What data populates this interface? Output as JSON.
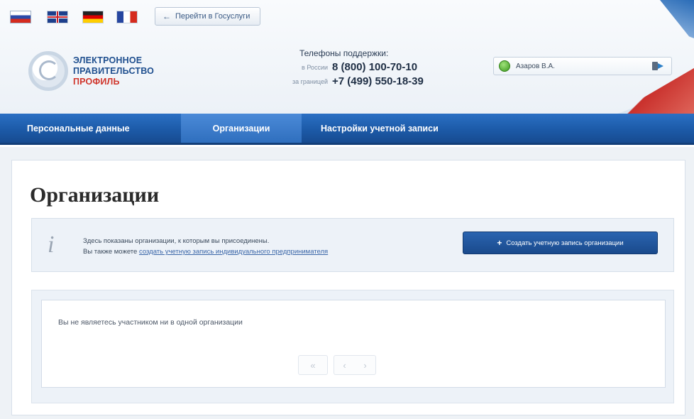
{
  "header": {
    "languages": [
      {
        "code": "ru",
        "icon": "flag-russia-icon"
      },
      {
        "code": "en",
        "icon": "flag-uk-icon"
      },
      {
        "code": "de",
        "icon": "flag-germany-icon"
      },
      {
        "code": "fr",
        "icon": "flag-france-icon"
      }
    ],
    "goto_button": "Перейти в Госуслуги",
    "logo": {
      "line1": "ЭЛЕКТРОННОЕ",
      "line2": "ПРАВИТЕЛЬСТВО",
      "line3": "ПРОФИЛЬ"
    },
    "support": {
      "title": "Телефоны поддержки:",
      "rows": [
        {
          "note": "в России",
          "number": "8 (800) 100-70-10"
        },
        {
          "note": "за границей",
          "number": "+7 (499) 550-18-39"
        }
      ]
    },
    "user": {
      "name": "Азаров В.А."
    }
  },
  "nav": {
    "items": [
      {
        "label": "Персональные данные",
        "active": false
      },
      {
        "label": "Организации",
        "active": true
      },
      {
        "label": "Настройки учетной записи",
        "active": false
      }
    ]
  },
  "main": {
    "title": "Организации",
    "info": {
      "line1": "Здесь показаны организации, к которым вы присоединены.",
      "line2_prefix": "Вы также можете",
      "line2_link": "создать учетную запись индивидуального предпринимателя"
    },
    "create_button": "Создать учетную запись организации",
    "empty_message": "Вы не являетесь участником ни в одной организации",
    "pager": {
      "first": "«",
      "prev": "‹",
      "next": "›"
    }
  },
  "colors": {
    "nav_blue": "#1c5aa8",
    "nav_active": "#3d7fd0",
    "button_blue": "#1a4a8c",
    "logo_blue": "#1f4f8f",
    "logo_red": "#d0362c"
  }
}
